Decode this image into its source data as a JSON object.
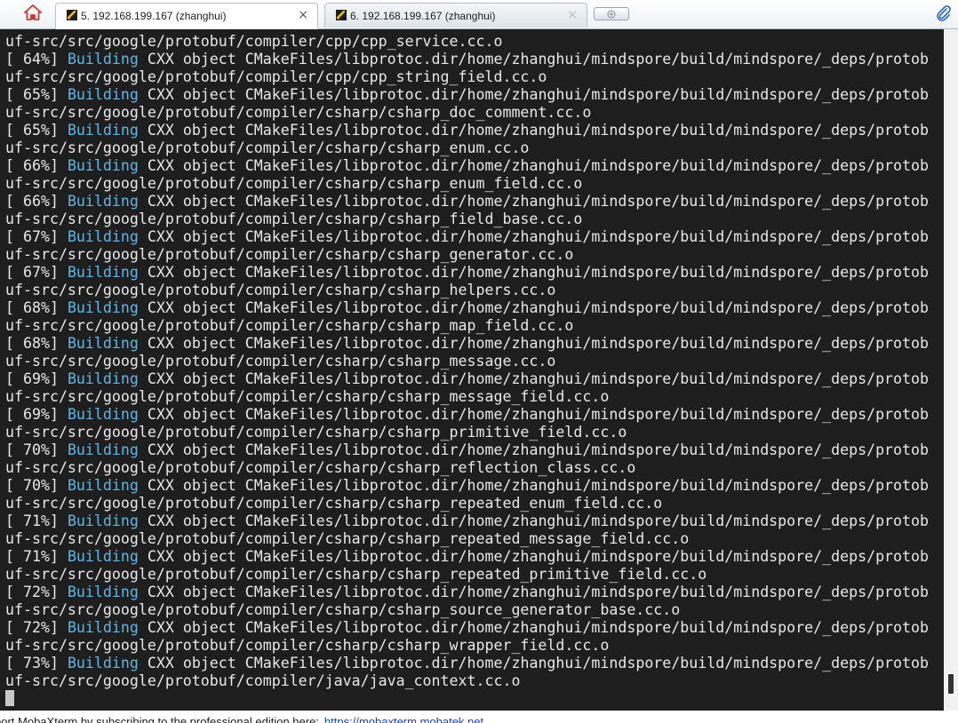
{
  "tabs": [
    {
      "title": "5. 192.168.199.167 (zhanghui)",
      "icon": "terminal-session-icon",
      "active": true
    },
    {
      "title": "6. 192.168.199.167 (zhanghui)",
      "icon": "terminal-session-icon",
      "active": false
    }
  ],
  "tab_close_glyph": "×",
  "terminal": {
    "lines": [
      {
        "text": "uf-src/src/google/protobuf/compiler/cpp/cpp_service.cc.o"
      },
      {
        "pre": "[ 64%] ",
        "kw": "Building",
        "post": " CXX object CMakeFiles/libprotoc.dir/home/zhanghui/mindspore/build/mindspore/_deps/protob"
      },
      {
        "text": "uf-src/src/google/protobuf/compiler/cpp/cpp_string_field.cc.o"
      },
      {
        "pre": "[ 65%] ",
        "kw": "Building",
        "post": " CXX object CMakeFiles/libprotoc.dir/home/zhanghui/mindspore/build/mindspore/_deps/protob"
      },
      {
        "text": "uf-src/src/google/protobuf/compiler/csharp/csharp_doc_comment.cc.o"
      },
      {
        "pre": "[ 65%] ",
        "kw": "Building",
        "post": " CXX object CMakeFiles/libprotoc.dir/home/zhanghui/mindspore/build/mindspore/_deps/protob"
      },
      {
        "text": "uf-src/src/google/protobuf/compiler/csharp/csharp_enum.cc.o"
      },
      {
        "pre": "[ 66%] ",
        "kw": "Building",
        "post": " CXX object CMakeFiles/libprotoc.dir/home/zhanghui/mindspore/build/mindspore/_deps/protob"
      },
      {
        "text": "uf-src/src/google/protobuf/compiler/csharp/csharp_enum_field.cc.o"
      },
      {
        "pre": "[ 66%] ",
        "kw": "Building",
        "post": " CXX object CMakeFiles/libprotoc.dir/home/zhanghui/mindspore/build/mindspore/_deps/protob"
      },
      {
        "text": "uf-src/src/google/protobuf/compiler/csharp/csharp_field_base.cc.o"
      },
      {
        "pre": "[ 67%] ",
        "kw": "Building",
        "post": " CXX object CMakeFiles/libprotoc.dir/home/zhanghui/mindspore/build/mindspore/_deps/protob"
      },
      {
        "text": "uf-src/src/google/protobuf/compiler/csharp/csharp_generator.cc.o"
      },
      {
        "pre": "[ 67%] ",
        "kw": "Building",
        "post": " CXX object CMakeFiles/libprotoc.dir/home/zhanghui/mindspore/build/mindspore/_deps/protob"
      },
      {
        "text": "uf-src/src/google/protobuf/compiler/csharp/csharp_helpers.cc.o"
      },
      {
        "pre": "[ 68%] ",
        "kw": "Building",
        "post": " CXX object CMakeFiles/libprotoc.dir/home/zhanghui/mindspore/build/mindspore/_deps/protob"
      },
      {
        "text": "uf-src/src/google/protobuf/compiler/csharp/csharp_map_field.cc.o"
      },
      {
        "pre": "[ 68%] ",
        "kw": "Building",
        "post": " CXX object CMakeFiles/libprotoc.dir/home/zhanghui/mindspore/build/mindspore/_deps/protob"
      },
      {
        "text": "uf-src/src/google/protobuf/compiler/csharp/csharp_message.cc.o"
      },
      {
        "pre": "[ 69%] ",
        "kw": "Building",
        "post": " CXX object CMakeFiles/libprotoc.dir/home/zhanghui/mindspore/build/mindspore/_deps/protob"
      },
      {
        "text": "uf-src/src/google/protobuf/compiler/csharp/csharp_message_field.cc.o"
      },
      {
        "pre": "[ 69%] ",
        "kw": "Building",
        "post": " CXX object CMakeFiles/libprotoc.dir/home/zhanghui/mindspore/build/mindspore/_deps/protob"
      },
      {
        "text": "uf-src/src/google/protobuf/compiler/csharp/csharp_primitive_field.cc.o"
      },
      {
        "pre": "[ 70%] ",
        "kw": "Building",
        "post": " CXX object CMakeFiles/libprotoc.dir/home/zhanghui/mindspore/build/mindspore/_deps/protob"
      },
      {
        "text": "uf-src/src/google/protobuf/compiler/csharp/csharp_reflection_class.cc.o"
      },
      {
        "pre": "[ 70%] ",
        "kw": "Building",
        "post": " CXX object CMakeFiles/libprotoc.dir/home/zhanghui/mindspore/build/mindspore/_deps/protob"
      },
      {
        "text": "uf-src/src/google/protobuf/compiler/csharp/csharp_repeated_enum_field.cc.o"
      },
      {
        "pre": "[ 71%] ",
        "kw": "Building",
        "post": " CXX object CMakeFiles/libprotoc.dir/home/zhanghui/mindspore/build/mindspore/_deps/protob"
      },
      {
        "text": "uf-src/src/google/protobuf/compiler/csharp/csharp_repeated_message_field.cc.o"
      },
      {
        "pre": "[ 71%] ",
        "kw": "Building",
        "post": " CXX object CMakeFiles/libprotoc.dir/home/zhanghui/mindspore/build/mindspore/_deps/protob"
      },
      {
        "text": "uf-src/src/google/protobuf/compiler/csharp/csharp_repeated_primitive_field.cc.o"
      },
      {
        "pre": "[ 72%] ",
        "kw": "Building",
        "post": " CXX object CMakeFiles/libprotoc.dir/home/zhanghui/mindspore/build/mindspore/_deps/protob"
      },
      {
        "text": "uf-src/src/google/protobuf/compiler/csharp/csharp_source_generator_base.cc.o"
      },
      {
        "pre": "[ 72%] ",
        "kw": "Building",
        "post": " CXX object CMakeFiles/libprotoc.dir/home/zhanghui/mindspore/build/mindspore/_deps/protob"
      },
      {
        "text": "uf-src/src/google/protobuf/compiler/csharp/csharp_wrapper_field.cc.o"
      },
      {
        "pre": "[ 73%] ",
        "kw": "Building",
        "post": " CXX object CMakeFiles/libprotoc.dir/home/zhanghui/mindspore/build/mindspore/_deps/protob"
      },
      {
        "text": "uf-src/src/google/protobuf/compiler/java/java_context.cc.o"
      }
    ]
  },
  "status": {
    "text": "port MobaXterm by subscribing to the professional edition here:",
    "link": "https://mobaxterm.mobatek.net"
  },
  "colors": {
    "terminal_bg": "#1e1e1e",
    "terminal_fg": "#e8e8e8",
    "keyword": "#5ab8e8",
    "link": "#1a45c8"
  },
  "icons": [
    "home-icon",
    "terminal-session-icon",
    "close-icon",
    "new-tab-icon",
    "paperclip-icon"
  ]
}
